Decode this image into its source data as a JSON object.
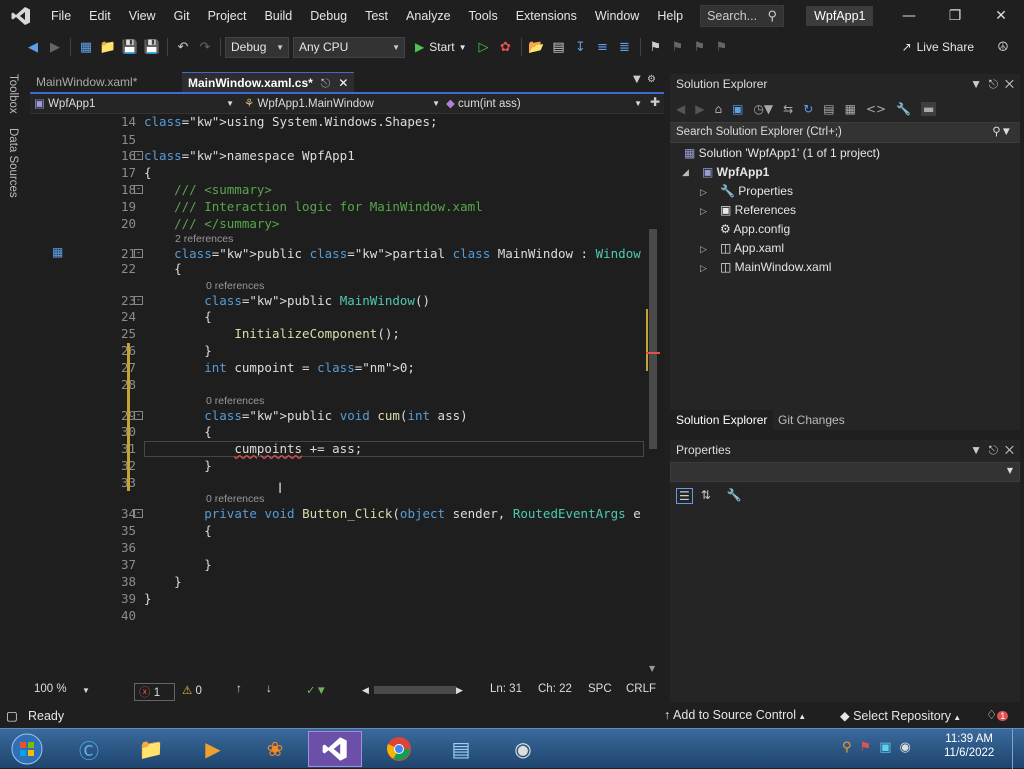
{
  "menu": [
    "File",
    "Edit",
    "View",
    "Git",
    "Project",
    "Build",
    "Debug",
    "Test",
    "Analyze",
    "Tools",
    "Extensions",
    "Window",
    "Help"
  ],
  "search_label": "Search...",
  "solution_name": "WpfApp1",
  "toolbar": {
    "config": "Debug",
    "platform": "Any CPU",
    "start": "Start",
    "live_share": "Live Share"
  },
  "left_strip": [
    "Toolbox",
    "Data Sources"
  ],
  "tabs": [
    {
      "label": "MainWindow.xaml*",
      "active": false
    },
    {
      "label": "MainWindow.xaml.cs*",
      "active": true
    }
  ],
  "nav": {
    "project": "WpfApp1",
    "class": "WpfApp1.MainWindow",
    "member": "cum(int ass)"
  },
  "lines": [
    {
      "n": "14",
      "text": "using System.Windows.Shapes;"
    },
    {
      "n": "15",
      "text": ""
    },
    {
      "n": "16",
      "text": "namespace WpfApp1"
    },
    {
      "n": "17",
      "text": "{"
    },
    {
      "n": "18",
      "text": "    /// <summary>"
    },
    {
      "n": "19",
      "text": "    /// Interaction logic for MainWindow.xaml"
    },
    {
      "n": "20",
      "text": "    /// </summary>"
    },
    {
      "n": "21",
      "text": "    public partial class MainWindow : Window"
    },
    {
      "n": "22",
      "text": "    {"
    },
    {
      "n": "23",
      "text": "        public MainWindow()"
    },
    {
      "n": "24",
      "text": "        {"
    },
    {
      "n": "25",
      "text": "            InitializeComponent();"
    },
    {
      "n": "26",
      "text": "        }"
    },
    {
      "n": "27",
      "text": "        int cumpoint = 0;"
    },
    {
      "n": "28",
      "text": ""
    },
    {
      "n": "29",
      "text": "        public void cum(int ass)"
    },
    {
      "n": "30",
      "text": "        {"
    },
    {
      "n": "31",
      "text": "            cumpoints += ass;"
    },
    {
      "n": "32",
      "text": "        }"
    },
    {
      "n": "33",
      "text": ""
    },
    {
      "n": "34",
      "text": "        private void Button_Click(object sender, RoutedEventArgs e"
    },
    {
      "n": "35",
      "text": "        {"
    },
    {
      "n": "36",
      "text": ""
    },
    {
      "n": "37",
      "text": "        }"
    },
    {
      "n": "38",
      "text": "    }"
    },
    {
      "n": "39",
      "text": "}"
    },
    {
      "n": "40",
      "text": ""
    }
  ],
  "codelens": {
    "class": "2 references",
    "ctor": "0 references",
    "cum": "0 references",
    "click": "0 references"
  },
  "editor_status": {
    "zoom": "100 %",
    "errors": "1",
    "warnings": "0",
    "ln": "Ln: 31",
    "ch": "Ch: 22",
    "spc": "SPC",
    "crlf": "CRLF"
  },
  "solution_explorer": {
    "title": "Solution Explorer",
    "search": "Search Solution Explorer (Ctrl+;)",
    "solution": "Solution 'WpfApp1' (1 of 1 project)",
    "project": "WpfApp1",
    "items": [
      "Properties",
      "References",
      "App.config",
      "App.xaml",
      "MainWindow.xaml"
    ],
    "bottom_tabs": [
      "Solution Explorer",
      "Git Changes"
    ]
  },
  "properties_title": "Properties",
  "status": {
    "ready": "Ready",
    "source_control": "Add to Source Control",
    "repo": "Select Repository",
    "notif": "1"
  },
  "clock": {
    "time": "11:39 AM",
    "date": "11/6/2022"
  }
}
